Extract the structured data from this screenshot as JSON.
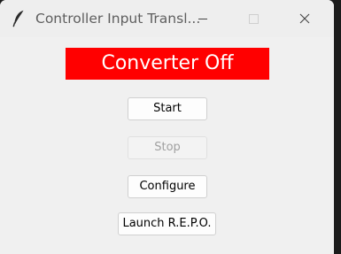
{
  "window": {
    "title": "Controller Input Transl...",
    "icon": "feather-icon"
  },
  "status": {
    "label": "Converter Off",
    "color": "#ff0000"
  },
  "buttons": {
    "start": "Start",
    "stop": "Stop",
    "configure": "Configure",
    "launch": "Launch R.E.P.O."
  }
}
